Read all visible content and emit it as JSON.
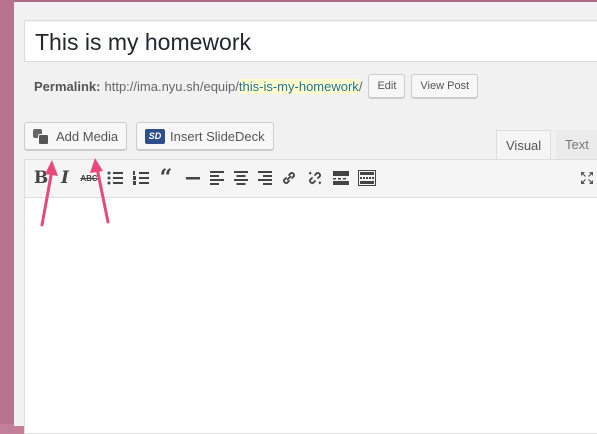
{
  "post": {
    "title": "This is my homework",
    "permalink_label": "Permalink:",
    "permalink_base": "http://ima.nyu.sh/equip/",
    "permalink_slug": "this-is-my-homework",
    "permalink_trailing": "/",
    "edit_label": "Edit",
    "view_post_label": "View Post"
  },
  "media_buttons": {
    "add_media_label": "Add Media",
    "slidedeck_label": "Insert SlideDeck",
    "slidedeck_icon_text": "SD"
  },
  "editor_tabs": {
    "visual_label": "Visual",
    "text_label": "Text"
  },
  "toolbar": {
    "bold_glyph": "B",
    "italic_glyph": "I",
    "strike_glyph": "ABC",
    "quote_glyph": "“",
    "icons": [
      "bold-icon",
      "italic-icon",
      "strikethrough-icon",
      "bullet-list-icon",
      "numbered-list-icon",
      "blockquote-icon",
      "horizontal-rule-icon",
      "align-left-icon",
      "align-center-icon",
      "align-right-icon",
      "insert-link-icon",
      "remove-link-icon",
      "read-more-icon",
      "toolbar-toggle-icon",
      "fullscreen-icon"
    ]
  },
  "colors": {
    "annotation_arrow": "#e8497a",
    "permalink_highlight": "#fffbcc",
    "slidedeck_brand": "#2d4e8a"
  }
}
